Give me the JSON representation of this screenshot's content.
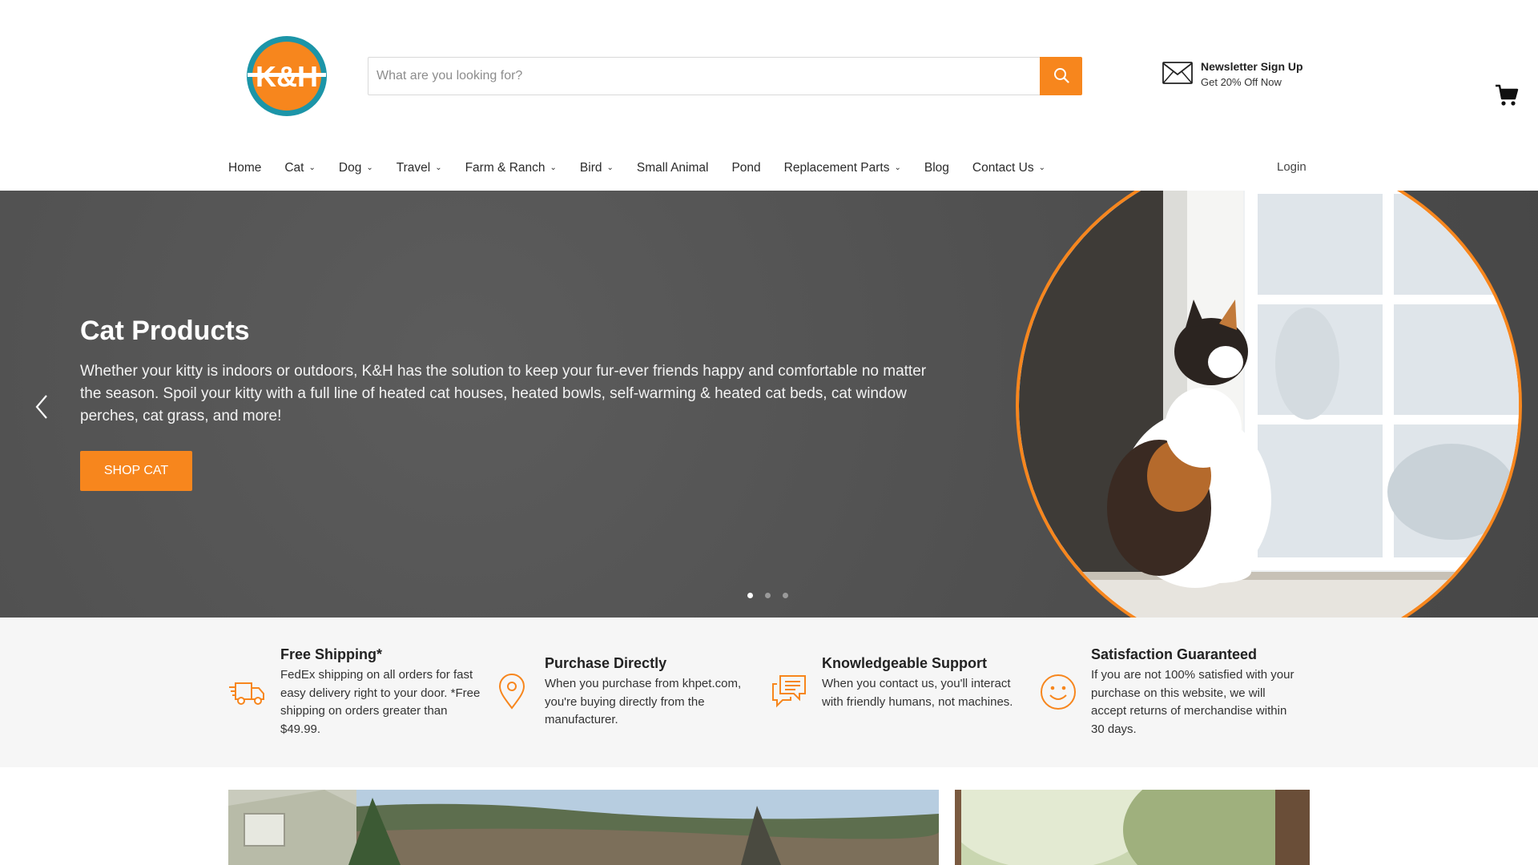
{
  "brand": {
    "logo_text": "K&H",
    "accent_color": "#f7861d",
    "ring_color": "#1c95a8"
  },
  "search": {
    "placeholder": "What are you looking for?",
    "value": "",
    "button_icon": "search-icon"
  },
  "newsletter": {
    "title": "Newsletter Sign Up",
    "subtitle": "Get 20% Off Now",
    "icon": "envelope-icon"
  },
  "cart": {
    "icon": "cart-icon"
  },
  "nav": {
    "items": [
      {
        "label": "Home",
        "has_dropdown": false
      },
      {
        "label": "Cat",
        "has_dropdown": true
      },
      {
        "label": "Dog",
        "has_dropdown": true
      },
      {
        "label": "Travel",
        "has_dropdown": true
      },
      {
        "label": "Farm & Ranch",
        "has_dropdown": true
      },
      {
        "label": "Bird",
        "has_dropdown": true
      },
      {
        "label": "Small Animal",
        "has_dropdown": false
      },
      {
        "label": "Pond",
        "has_dropdown": false
      },
      {
        "label": "Replacement Parts",
        "has_dropdown": true
      },
      {
        "label": "Blog",
        "has_dropdown": false
      },
      {
        "label": "Contact Us",
        "has_dropdown": true
      }
    ],
    "login": "Login"
  },
  "hero": {
    "title": "Cat Products",
    "description": "Whether your kitty is indoors or outdoors, K&H has the solution to keep your fur-ever friends happy and comfortable no matter the season. Spoil your kitty with a full line of heated cat houses, heated bowls, self-warming & heated cat beds, cat window perches, cat grass, and more!",
    "cta": "SHOP CAT",
    "slides_count": 3,
    "active_slide": 1,
    "background_color": "#545454"
  },
  "features": [
    {
      "icon": "delivery-truck-icon",
      "title": "Free Shipping*",
      "description": "FedEx shipping on all orders for fast easy delivery right to your door. *Free shipping on orders greater than $49.99."
    },
    {
      "icon": "location-pin-icon",
      "title": "Purchase Directly",
      "description": "When you purchase from khpet.com, you're buying directly from the manufacturer."
    },
    {
      "icon": "chat-bubbles-icon",
      "title": "Knowledgeable Support",
      "description": "When you contact us, you'll interact with friendly humans, not machines."
    },
    {
      "icon": "smiley-face-icon",
      "title": "Satisfaction Guaranteed",
      "description": "If you are not 100% satisfied with your purchase on this website, we will accept returns of merchandise within 30 days."
    }
  ]
}
